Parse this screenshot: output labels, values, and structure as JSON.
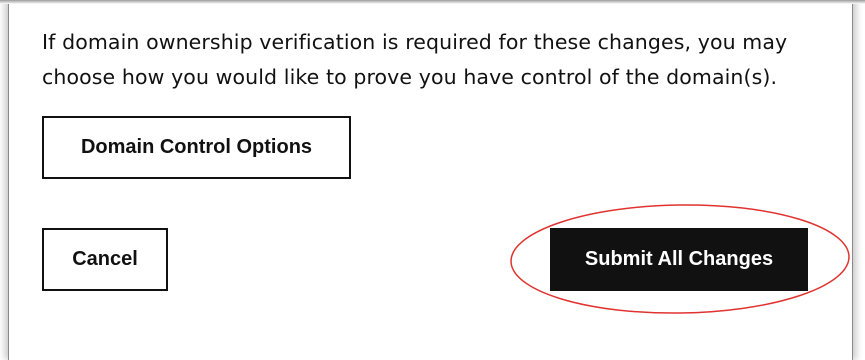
{
  "dialog": {
    "description": "If domain ownership verification is required for these changes, you may choose how you would like to prove you have control of the domain(s).",
    "domain_control_label": "Domain Control Options",
    "cancel_label": "Cancel",
    "submit_label": "Submit All Changes"
  },
  "colors": {
    "text": "#111111",
    "button_primary_bg": "#111111",
    "button_primary_text": "#ffffff",
    "annotation_circle": "#e0332f"
  }
}
